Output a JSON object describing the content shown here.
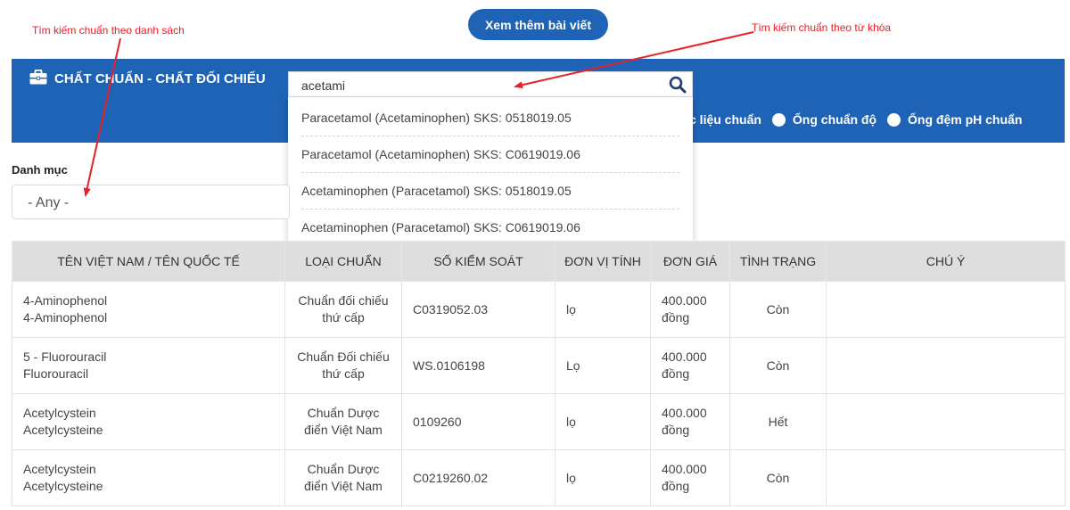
{
  "more_button": "Xem thêm bài viết",
  "annotations": {
    "list_search": "Tìm kiếm chuẩn theo danh sách",
    "keyword_search": "Tìm kiếm chuẩn theo từ khóa",
    "color": "#e8202a"
  },
  "banner": {
    "title": "CHẤT CHUẨN - CHẤT ĐỐI CHIẾU",
    "icon": "briefcase-icon",
    "color": "#1e63b5",
    "options": [
      "c liệu chuẩn",
      "Ống chuẩn độ",
      "Ống đệm pH chuẩn"
    ]
  },
  "search": {
    "value": "acetami",
    "icon": "search-icon",
    "suggestions": [
      "Paracetamol (Acetaminophen) SKS: 0518019.05",
      "Paracetamol (Acetaminophen) SKS: C0619019.06",
      "Acetaminophen (Paracetamol) SKS: 0518019.05",
      "Acetaminophen (Paracetamol) SKS: C0619019.06"
    ]
  },
  "category": {
    "label": "Danh mục",
    "selected": "- Any -"
  },
  "table": {
    "headers": [
      "TÊN VIỆT NAM / TÊN QUỐC TẾ",
      "LOẠI CHUẨN",
      "SỐ KIỂM SOÁT",
      "ĐƠN VỊ TÍNH",
      "ĐƠN GIÁ",
      "TÌNH TRẠNG",
      "CHÚ Ý"
    ],
    "rows": [
      {
        "name_vn": "4-Aminophenol",
        "name_intl": "4-Aminophenol",
        "type_l1": "Chuẩn đối chiếu",
        "type_l2": "thứ cấp",
        "code": "C0319052.03",
        "unit": "lọ",
        "price_l1": "400.000",
        "price_l2": "đồng",
        "status": "Còn",
        "note": ""
      },
      {
        "name_vn": "5 - Fluorouracil",
        "name_intl": "Fluorouracil",
        "type_l1": "Chuẩn Đối chiếu",
        "type_l2": "thứ cấp",
        "code": "WS.0106198",
        "unit": "Lọ",
        "price_l1": "400.000",
        "price_l2": "đồng",
        "status": "Còn",
        "note": ""
      },
      {
        "name_vn": "Acetylcystein",
        "name_intl": "Acetylcysteine",
        "type_l1": "Chuẩn Dược",
        "type_l2": "điển Việt Nam",
        "code": "0109260",
        "unit": "lọ",
        "price_l1": "400.000",
        "price_l2": "đồng",
        "status": "Hết",
        "note": ""
      },
      {
        "name_vn": "Acetylcystein",
        "name_intl": "Acetylcysteine",
        "type_l1": "Chuẩn Dược",
        "type_l2": "điển Việt Nam",
        "code": "C0219260.02",
        "unit": "lọ",
        "price_l1": "400.000",
        "price_l2": "đồng",
        "status": "Còn",
        "note": ""
      }
    ]
  }
}
